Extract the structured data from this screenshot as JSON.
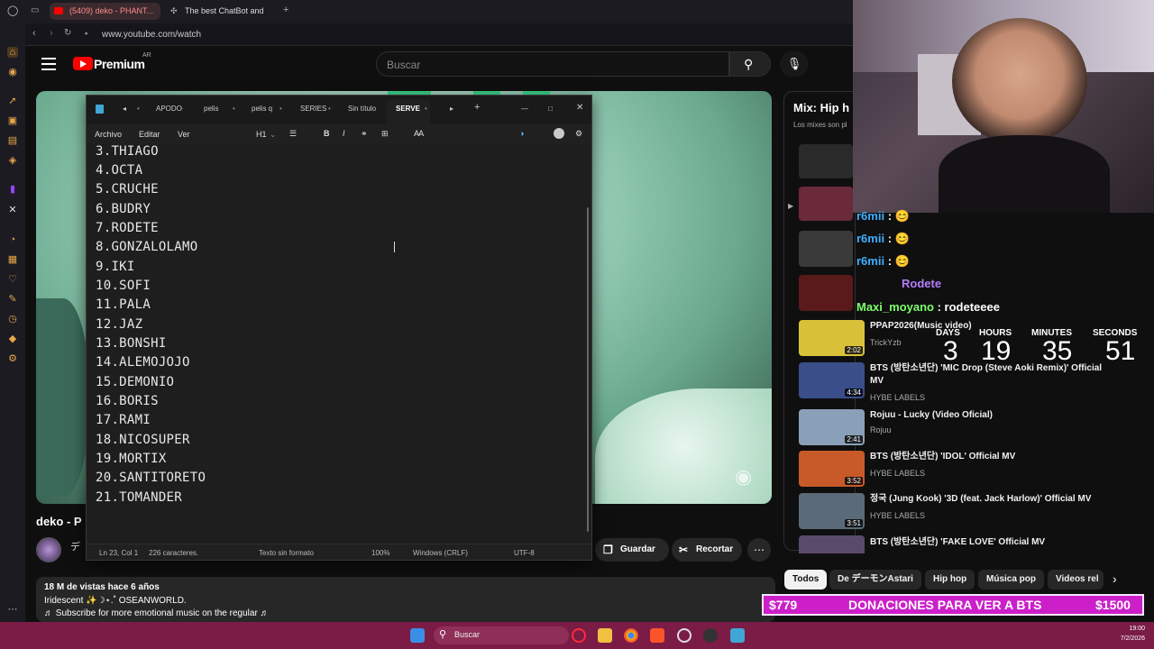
{
  "browser": {
    "tabs": [
      {
        "label": "(5409) deko - PHANT..."
      },
      {
        "label": "The best ChatBot and"
      }
    ],
    "url": "www.youtube.com/watch"
  },
  "youtube": {
    "logo": "Premium",
    "region": "AR",
    "search_placeholder": "Buscar",
    "video_title": "deko - P",
    "channel_abbr": "デ",
    "views": "18 M de vistas  hace 6 años",
    "desc_line1": "Iridescent ✨☽⋆.˚ OSEANWORLD.",
    "desc_line2": "♬ Subscribe for more emotional music on the regular ♬",
    "save_label": "Guardar",
    "clip_label": "Recortar",
    "mix_title": "Mix: Hip h",
    "mix_sub": "Los mixes son pl",
    "recommended": [
      {
        "title": "PPAP2026(Music video)",
        "channel": "TrickYzb",
        "duration": "2:02",
        "color": "#d9c23a"
      },
      {
        "title": "BTS (방탄소년단) 'MIC Drop (Steve Aoki Remix)' Official MV",
        "channel": "HYBE LABELS",
        "duration": "4:34",
        "color": "#3a4e8a"
      },
      {
        "title": "Rojuu - Lucky (Video Oficial)",
        "channel": "Rojuu",
        "duration": "2:41",
        "color": "#8aa0b8"
      },
      {
        "title": "BTS (방탄소년단) 'IDOL' Official MV",
        "channel": "HYBE LABELS",
        "duration": "3:52",
        "color": "#c85a2a"
      },
      {
        "title": "정국 (Jung Kook) '3D (feat. Jack Harlow)' Official MV",
        "channel": "HYBE LABELS",
        "duration": "3:51",
        "color": "#5a6a78"
      },
      {
        "title": "BTS (방탄소년단) 'FAKE LOVE' Official MV",
        "channel": "",
        "duration": "",
        "color": "#5a4a6a"
      }
    ],
    "chips": [
      "Todos",
      "De デーモンAstari",
      "Hip hop",
      "Música pop",
      "Videos rel"
    ]
  },
  "notepad": {
    "tabs": [
      "APODO",
      "pelis",
      "pelis q",
      "SERIES",
      "Sin título",
      "SERVE"
    ],
    "menu": [
      "Archivo",
      "Editar",
      "Ver"
    ],
    "heading": "H1",
    "lines": [
      "3.THIAGO",
      "4.OCTA",
      "5.CRUCHE",
      "6.BUDRY",
      "7.RODETE",
      "8.GONZALOLAMO",
      "9.IKI",
      "10.SOFI",
      "11.PALA",
      "12.JAZ",
      "13.BONSHI",
      "14.ALEMOJOJO",
      "15.DEMONIO",
      "16.BORIS",
      "17.RAMI",
      "18.NICOSUPER",
      "19.MORTIX",
      "20.SANTITORETO",
      "21.TOMANDER"
    ],
    "status": {
      "position": "Ln 23, Col 1",
      "chars": "226 caracteres.",
      "format": "Texto sin formato",
      "zoom": "100%",
      "eol": "Windows (CRLF)",
      "encoding": "UTF-8"
    }
  },
  "stream": {
    "chat": [
      {
        "user": "r6mii",
        "msg": ": 😊"
      },
      {
        "user": "r6mii",
        "msg": ": 😊"
      },
      {
        "user": "r6mii",
        "msg": ": 😊"
      },
      {
        "user": "Rodete",
        "msg": ""
      },
      {
        "user": "Maxi_moyano",
        "msg": ": rodeteeee"
      }
    ],
    "countdown": {
      "days_label": "DAYS",
      "hours_label": "HOURS",
      "minutes_label": "MINUTES",
      "seconds_label": "SECONDS",
      "days": "3",
      "hours": "19",
      "minutes": "35",
      "seconds": "51"
    },
    "donation": {
      "left": "$779",
      "title": "DONACIONES PARA VER A BTS",
      "right": "$1500"
    }
  },
  "taskbar": {
    "search": "Buscar",
    "time": "19:00",
    "date": "7/2/2026"
  }
}
